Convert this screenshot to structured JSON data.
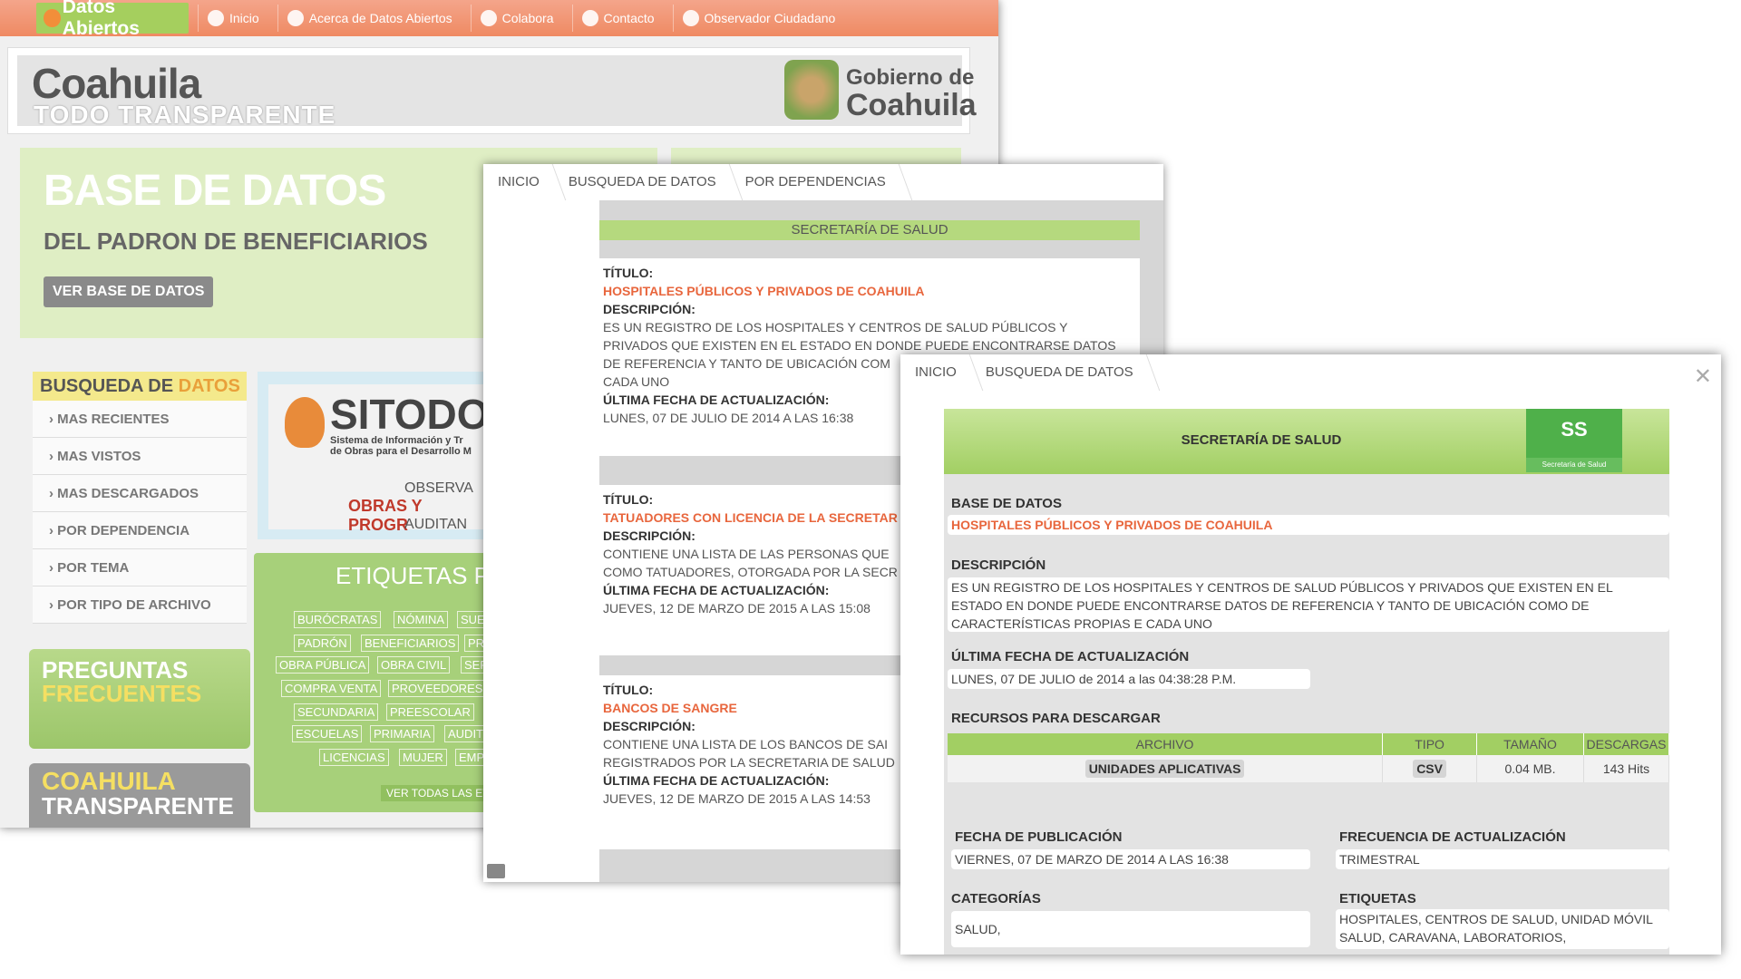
{
  "portal": {
    "nav": {
      "logo": "Datos Abiertos",
      "items": [
        "Inicio",
        "Acerca de Datos Abiertos",
        "Colabora",
        "Contacto",
        "Observador Ciudadano"
      ]
    },
    "header": {
      "title": "Coahuila",
      "subtitle": "TODO TRANSPARENTE",
      "gob_line1": "Gobierno de",
      "gob_line2": "Coahuila"
    },
    "banner": {
      "title": "BASE DE DATOS",
      "subtitle": "DEL PADRON DE BENEFICIARIOS",
      "button": "VER BASE DE DATOS"
    },
    "busqueda": {
      "title_a": "BUSQUEDA DE",
      "title_b": "DATOS",
      "items": [
        "MAS RECIENTES",
        "MAS VISTOS",
        "MAS DESCARGADOS",
        "POR DEPENDENCIA",
        "POR TEMA",
        "POR TIPO DE ARCHIVO"
      ]
    },
    "faq": {
      "line1": "PREGUNTAS",
      "line2": "FRECUENTES"
    },
    "coahuila_transparente": {
      "line1": "COAHUILA",
      "line2": "TRANSPARENTE"
    },
    "sitodo": {
      "title": "SITODO",
      "sub1": "Sistema de Información y Tr",
      "sub2": "de Obras para el Desarrollo M",
      "obs": "OBSERVA",
      "obras": "OBRAS Y PROGR",
      "auditan": "AUDITAN"
    },
    "etiquetas": {
      "title": "ETIQUETAS POR",
      "tags": [
        "BURÓCRATAS",
        "NÓMINA",
        "SUE",
        "PADRÓN",
        "BENEFICIARIOS",
        "PR",
        "OBRA PÚBLICA",
        "OBRA CIVIL",
        "SER",
        "COMPRA VENTA",
        "PROVEEDORES",
        "SECUNDARIA",
        "PREESCOLAR",
        "ESCUELAS",
        "PRIMARIA",
        "AUDITO",
        "LICENCIAS",
        "MUJER",
        "EMP"
      ],
      "all": "VER TODAS LAS ET"
    }
  },
  "search": {
    "breadcrumb": [
      "INICIO",
      "BUSQUEDA DE DATOS",
      "POR DEPENDENCIAS"
    ],
    "dependency": "SECRETARÍA DE SALUD",
    "labels": {
      "titulo": "TÍTULO:",
      "descripcion": "DESCRIPCIÓN:",
      "fecha": "ÚLTIMA FECHA DE ACTUALIZACIÓN:"
    },
    "records": [
      {
        "title": "HOSPITALES PÚBLICOS Y PRIVADOS DE COAHUILA",
        "desc1": "ES UN REGISTRO DE LOS HOSPITALES Y CENTROS DE SALUD PÚBLICOS Y",
        "desc2": "PRIVADOS QUE EXISTEN EN EL ESTADO EN DONDE PUEDE ENCONTRARSE DATOS",
        "desc3": "DE REFERENCIA Y TANTO DE UBICACIÓN COM",
        "desc4": "CADA UNO",
        "date": "LUNES, 07 DE JULIO DE 2014 A LAS 16:38"
      },
      {
        "title": "TATUADORES CON LICENCIA DE LA SECRETAR",
        "desc1": "CONTIENE UNA LISTA DE LAS PERSONAS QUE",
        "desc2": "COMO TATUADORES, OTORGADA POR LA SECR",
        "date": "JUEVES, 12 DE MARZO DE 2015 A LAS 15:08"
      },
      {
        "title": "BANCOS DE SANGRE",
        "desc1": "CONTIENE UNA LISTA DE LOS BANCOS DE SAI",
        "desc2": "REGISTRADOS POR LA SECRETARIA DE SALUD",
        "date": "JUEVES, 12 DE MARZO DE 2015 A LAS 14:53"
      }
    ]
  },
  "detail": {
    "breadcrumb": [
      "INICIO",
      "BUSQUEDA DE DATOS"
    ],
    "close": "✕",
    "dependency": "SECRETARÍA DE SALUD",
    "badge": {
      "abbr": "SS",
      "name": "Secretaría de Salud"
    },
    "base_label": "BASE DE DATOS",
    "base_value": "HOSPITALES PÚBLICOS Y PRIVADOS DE COAHUILA",
    "desc_label": "DESCRIPCIÓN",
    "desc_value": "ES UN REGISTRO DE LOS HOSPITALES Y CENTROS DE SALUD PÚBLICOS Y PRIVADOS QUE EXISTEN EN EL ESTADO EN DONDE PUEDE ENCONTRARSE DATOS DE REFERENCIA Y TANTO DE UBICACIÓN COMO DE CARACTERÍSTICAS PROPIAS E CADA UNO",
    "update_label": "ÚLTIMA FECHA DE ACTUALIZACIÓN",
    "update_value": "LUNES, 07 DE JULIO de 2014 a las 04:38:28 P.M.",
    "resources_label": "RECURSOS PARA DESCARGAR",
    "table": {
      "headers": [
        "ARCHIVO",
        "TIPO",
        "TAMAÑO",
        "DESCARGAS"
      ],
      "row": {
        "archivo": "UNIDADES APLICATIVAS",
        "tipo": "CSV",
        "tamano": "0.04 MB.",
        "descargas": "143 Hits"
      }
    },
    "pub_label": "FECHA DE PUBLICACIÓN",
    "pub_value": "VIERNES, 07 DE MARZO DE 2014 A LAS 16:38",
    "freq_label": "FRECUENCIA DE ACTUALIZACIÓN",
    "freq_value": "TRIMESTRAL",
    "cat_label": "CATEGORÍAS",
    "cat_value": "SALUD,",
    "tags_label": "ETIQUETAS",
    "tags_value": "HOSPITALES, CENTROS DE SALUD, UNIDAD MÓVIL SALUD, CARAVANA, LABORATORIOS,"
  }
}
